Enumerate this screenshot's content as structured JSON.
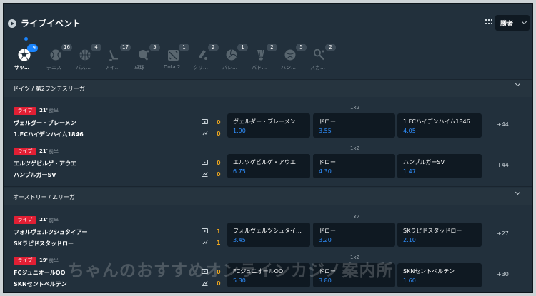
{
  "header": {
    "title": "ライブイベント",
    "market_select": "勝者"
  },
  "sports": [
    {
      "label": "サッ…",
      "count": "19",
      "icon": "soccer-ball-icon",
      "active": true
    },
    {
      "label": "テニス",
      "count": "16",
      "icon": "tennis-ball-icon"
    },
    {
      "label": "バス…",
      "count": "4",
      "icon": "basketball-icon"
    },
    {
      "label": "アイ…",
      "count": "17",
      "icon": "ice-hockey-icon"
    },
    {
      "label": "卓球",
      "count": "5",
      "icon": "table-tennis-icon"
    },
    {
      "label": "Dota 2",
      "count": "1",
      "icon": "dota2-icon"
    },
    {
      "label": "クリ…",
      "count": "2",
      "icon": "cricket-icon"
    },
    {
      "label": "バレ…",
      "count": "1",
      "icon": "volleyball-icon"
    },
    {
      "label": "バド…",
      "count": "2",
      "icon": "badminton-icon"
    },
    {
      "label": "ハン…",
      "count": "5",
      "icon": "handball-icon"
    },
    {
      "label": "スカ…",
      "count": "2",
      "icon": "squash-icon"
    }
  ],
  "leagues": [
    {
      "name": "ドイツ / 第2ブンデスリーガ",
      "matches": [
        {
          "live": "ライブ",
          "time": "21'",
          "period": "前半",
          "team1": "ヴェルダー・ブレーメン",
          "team2": "1.FCハイデンハイム1846",
          "score1": "0",
          "score2": "0",
          "market": "1x2",
          "odds": [
            {
              "name": "ヴェルダー・ブレーメン",
              "value": "1.90"
            },
            {
              "name": "ドロー",
              "value": "3.55"
            },
            {
              "name": "1.FCハイデンハイム1846",
              "value": "4.05"
            }
          ],
          "more": "+44"
        },
        {
          "live": "ライブ",
          "time": "21'",
          "period": "前半",
          "team1": "エルツゲビルゲ・アウエ",
          "team2": "ハンブルガーSV",
          "score1": "0",
          "score2": "0",
          "market": "1x2",
          "odds": [
            {
              "name": "エルツゲビルゲ・アウエ",
              "value": "6.75"
            },
            {
              "name": "ドロー",
              "value": "4.30"
            },
            {
              "name": "ハンブルガーSV",
              "value": "1.47"
            }
          ],
          "more": "+44"
        }
      ]
    },
    {
      "name": "オーストリー / 2.リーガ",
      "matches": [
        {
          "live": "ライブ",
          "time": "21'",
          "period": "前半",
          "team1": "フォルヴェルツシュタイアー",
          "team2": "SKラピドスタッドロー",
          "score1": "1",
          "score2": "1",
          "market": "1x2",
          "odds": [
            {
              "name": "フォルヴェルツシュタイ…",
              "value": "3.45"
            },
            {
              "name": "ドロー",
              "value": "3.20"
            },
            {
              "name": "SKラピドスタッドロー",
              "value": "2.10"
            }
          ],
          "more": "+27"
        },
        {
          "live": "ライブ",
          "time": "19'",
          "period": "前半",
          "team1": "FCジュニオールOO",
          "team2": "SKNセントペルテン",
          "score1": "0",
          "score2": "0",
          "market": "1x2",
          "odds": [
            {
              "name": "FCジュニオールOO",
              "value": "5.30"
            },
            {
              "name": "ドロー",
              "value": "3.80"
            },
            {
              "name": "SKNセントペルテン",
              "value": "1.60"
            }
          ],
          "more": "+30"
        }
      ]
    }
  ],
  "watermark": "ちゃんのおすすめオンラインカジノ案内所"
}
